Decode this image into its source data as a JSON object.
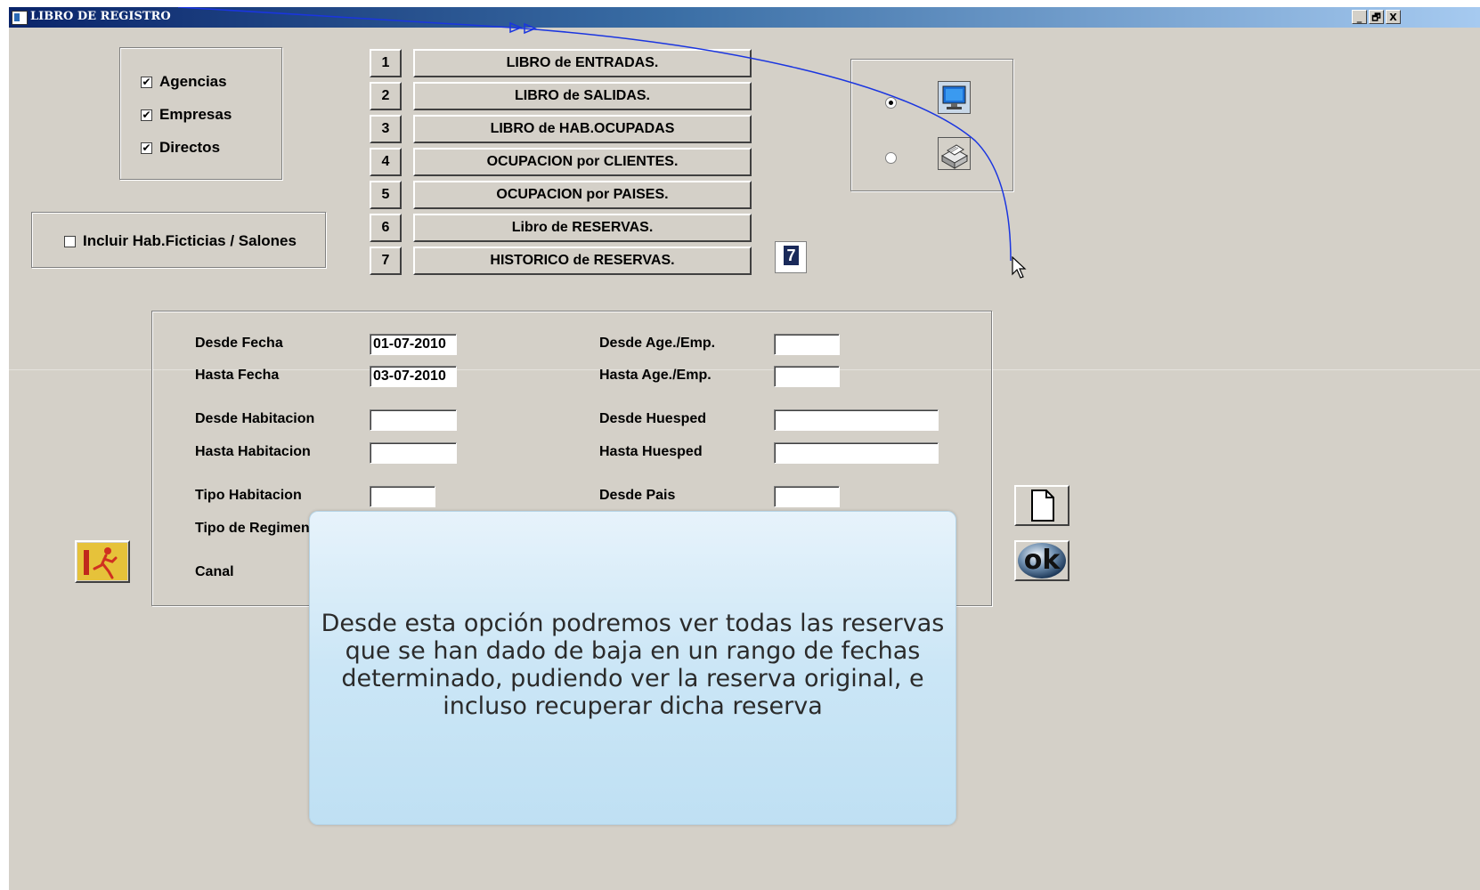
{
  "window": {
    "title": "LIBRO DE REGISTRO",
    "controls": {
      "minimize": "_",
      "restore": "🗗",
      "close": "X"
    }
  },
  "filters": [
    {
      "label": "Agencias",
      "checked": true
    },
    {
      "label": "Empresas",
      "checked": true
    },
    {
      "label": "Directos",
      "checked": true
    }
  ],
  "include_fictitious": {
    "label": "Incluir Hab.Ficticias / Salones",
    "checked": false
  },
  "reports": [
    {
      "num": "1",
      "label": "LIBRO de ENTRADAS."
    },
    {
      "num": "2",
      "label": "LIBRO de SALIDAS."
    },
    {
      "num": "3",
      "label": "LIBRO de HAB.OCUPADAS"
    },
    {
      "num": "4",
      "label": "OCUPACION por CLIENTES."
    },
    {
      "num": "5",
      "label": "OCUPACION por PAISES."
    },
    {
      "num": "6",
      "label": "Libro  de  RESERVAS."
    },
    {
      "num": "7",
      "label": "HISTORICO de RESERVAS."
    }
  ],
  "selected_report": "7",
  "output": {
    "screen_selected": true,
    "printer_selected": false,
    "screen_icon": "monitor-icon",
    "printer_icon": "printer-icon"
  },
  "form": {
    "desde_fecha": {
      "label": "Desde Fecha",
      "value": "01-07-2010"
    },
    "hasta_fecha": {
      "label": "Hasta Fecha",
      "value": "03-07-2010"
    },
    "desde_hab": {
      "label": "Desde Habitacion",
      "value": ""
    },
    "hasta_hab": {
      "label": "Hasta Habitacion",
      "value": ""
    },
    "tipo_hab": {
      "label": "Tipo Habitacion",
      "value": ""
    },
    "tipo_regimen": {
      "label": "Tipo de Regimen"
    },
    "canal": {
      "label": "Canal"
    },
    "desde_age": {
      "label": "Desde Age./Emp.",
      "value": ""
    },
    "hasta_age": {
      "label": "Hasta Age./Emp.",
      "value": ""
    },
    "desde_huesped": {
      "label": "Desde Huesped",
      "value": ""
    },
    "hasta_huesped": {
      "label": "Hasta Huesped",
      "value": ""
    },
    "desde_pais": {
      "label": "Desde  Pais",
      "value": ""
    }
  },
  "actions": {
    "new_icon": "document-icon",
    "ok_icon": "ok-icon",
    "exit_icon": "exit-icon",
    "ok_label": "ok"
  },
  "tooltip": {
    "text": "Desde esta opción podremos ver todas las reservas que se han dado de baja en un rango de fechas determinado, pudiendo ver la reserva original, e incluso recuperar dicha reserva"
  }
}
